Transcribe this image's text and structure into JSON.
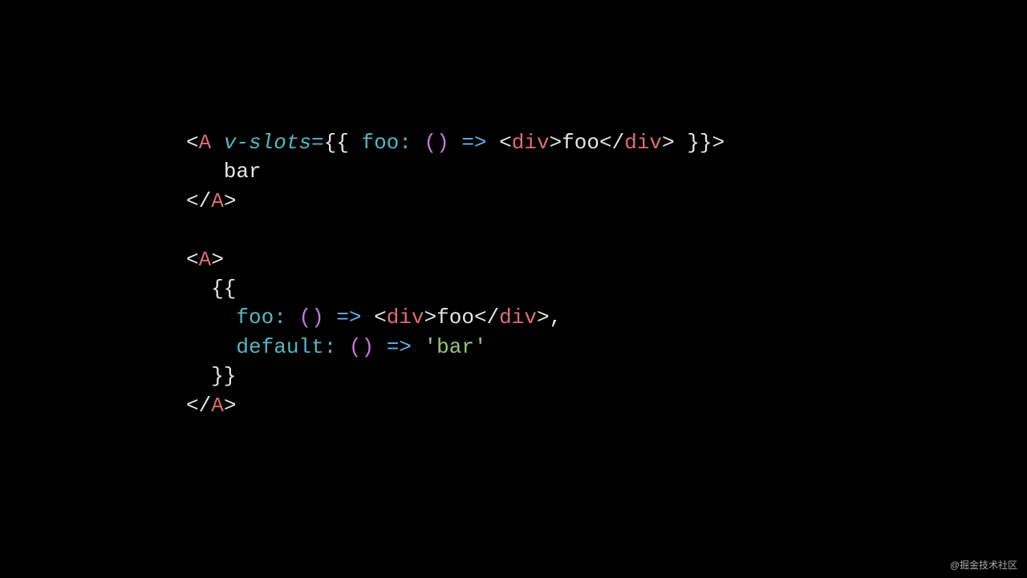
{
  "watermark": "@掘金技术社区",
  "code": {
    "l1": {
      "t01": "<",
      "t02": "A",
      "t03": " ",
      "t04": "v-slots=",
      "t05": "{{ ",
      "t06": "foo:",
      "t07": " ",
      "t08": "(",
      "t09": ")",
      "t10": " ",
      "t11": "=>",
      "t12": " ",
      "t13": "<",
      "t14": "div",
      "t15": ">",
      "t16": "foo",
      "t17": "</",
      "t18": "div",
      "t19": ">",
      "t20": " }}>"
    },
    "l2": {
      "t01": "   bar"
    },
    "l3": {
      "t01": "</",
      "t02": "A",
      "t03": ">"
    },
    "l4": {
      "t01": ""
    },
    "l5": {
      "t01": "<",
      "t02": "A",
      "t03": ">"
    },
    "l6": {
      "t01": "  {{"
    },
    "l7": {
      "t01": "    ",
      "t02": "foo:",
      "t03": " ",
      "t04": "(",
      "t05": ")",
      "t06": " ",
      "t07": "=>",
      "t08": " ",
      "t09": "<",
      "t10": "div",
      "t11": ">",
      "t12": "foo",
      "t13": "</",
      "t14": "div",
      "t15": ">",
      "t16": ","
    },
    "l8": {
      "t01": "    ",
      "t02": "default:",
      "t03": " ",
      "t04": "(",
      "t05": ")",
      "t06": " ",
      "t07": "=>",
      "t08": " ",
      "t09": "'bar'"
    },
    "l9": {
      "t01": "  }}"
    },
    "l10": {
      "t01": "</",
      "t02": "A",
      "t03": ">"
    }
  }
}
